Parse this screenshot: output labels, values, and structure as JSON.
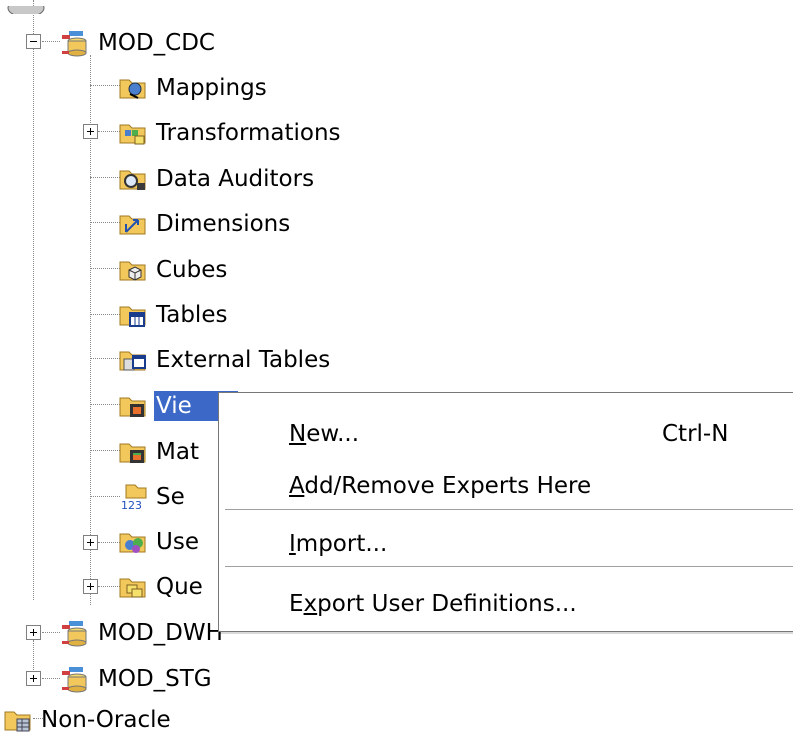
{
  "tree": {
    "items": [
      {
        "label": "MOD_CDC",
        "icon": "database-module-icon",
        "expander": "minus"
      },
      {
        "label": "Mappings",
        "icon": "mappings-folder-icon"
      },
      {
        "label": "Transformations",
        "icon": "transformations-folder-icon",
        "expander": "plus"
      },
      {
        "label": "Data Auditors",
        "icon": "data-auditors-folder-icon"
      },
      {
        "label": "Dimensions",
        "icon": "dimensions-folder-icon"
      },
      {
        "label": "Cubes",
        "icon": "cubes-folder-icon"
      },
      {
        "label": "Tables",
        "icon": "tables-folder-icon"
      },
      {
        "label": "External Tables",
        "icon": "external-tables-folder-icon"
      },
      {
        "label": "Vie",
        "icon": "views-folder-icon",
        "selected": true
      },
      {
        "label": "Mat",
        "icon": "materialized-views-folder-icon"
      },
      {
        "label": "Se",
        "icon": "sequences-folder-icon"
      },
      {
        "label": "Use",
        "icon": "user-types-folder-icon",
        "expander": "plus"
      },
      {
        "label": "Que",
        "icon": "queues-folder-icon",
        "expander": "plus"
      },
      {
        "label": "MOD_DWH",
        "icon": "database-module-icon",
        "expander": "plus"
      },
      {
        "label": "MOD_STG",
        "icon": "database-module-icon",
        "expander": "plus"
      },
      {
        "label": "Non-Oracle",
        "icon": "non-oracle-folder-icon"
      }
    ]
  },
  "context_menu": {
    "items": [
      {
        "mnemonic": "N",
        "rest": "ew...",
        "shortcut": "Ctrl-N"
      },
      {
        "mnemonic": "A",
        "rest": "dd/Remove Experts Here",
        "shortcut": ""
      },
      {
        "mnemonic": "I",
        "rest": "mport...",
        "shortcut": ""
      },
      {
        "pre": "E",
        "mnemonic": "x",
        "rest": "port User Definitions...",
        "shortcut": ""
      }
    ]
  },
  "colors": {
    "selection": "#3c69c8",
    "folder": "#f2c75c",
    "db_green": "#4cae4c"
  }
}
